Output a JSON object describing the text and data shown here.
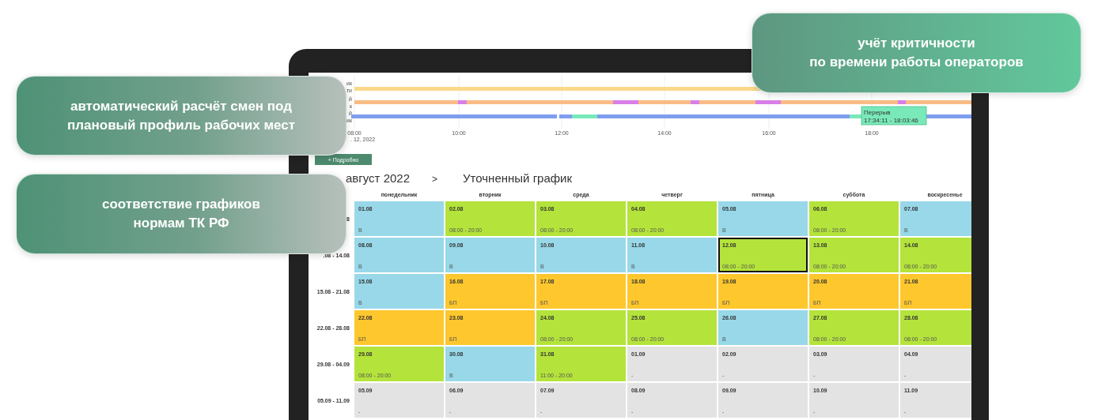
{
  "callouts": [
    {
      "lines": [
        "автоматический расчёт смен под",
        "плановый профиль рабочих мест"
      ]
    },
    {
      "lines": [
        "соответствие графиков",
        "нормам ТК РФ"
      ]
    },
    {
      "lines": [
        "учёт критичности",
        "по времени работы операторов"
      ]
    }
  ],
  "timeline": {
    "row_labels": [
      "ик",
      "ти",
      "й",
      "к",
      "й",
      "ик"
    ],
    "ticks": [
      "08:00",
      "10:00",
      "12:00",
      "14:00",
      "16:00",
      "18:00"
    ],
    "date": ". 12, 2022",
    "tooltip": {
      "title": "Перерыв",
      "range": "17:34:11 - 18:03:46"
    }
  },
  "details_button": "+ Подробно",
  "breadcrumb": {
    "month": "август 2022",
    "separator": ">",
    "view": "Уточненный график"
  },
  "table": {
    "weekdays": [
      "понедельник",
      "вторник",
      "среда",
      "четверг",
      "пятница",
      "суббота",
      "воскресенье"
    ],
    "weeks": [
      {
        "label": "8",
        "days": [
          {
            "date": "01.08",
            "kind": "off",
            "note": "В",
            "selected": false
          },
          {
            "date": "02.08",
            "kind": "shift",
            "note": "08:00 - 20:00",
            "selected": false
          },
          {
            "date": "03.08",
            "kind": "shift",
            "note": "08:00 - 20:00",
            "selected": false
          },
          {
            "date": "04.08",
            "kind": "shift",
            "note": "08:00 - 20:00",
            "selected": false
          },
          {
            "date": "05.08",
            "kind": "off",
            "note": "В",
            "selected": false
          },
          {
            "date": "06.08",
            "kind": "shift",
            "note": "08:00 - 20:00",
            "selected": false
          },
          {
            "date": "07.08",
            "kind": "off",
            "note": "В",
            "selected": false
          }
        ]
      },
      {
        "label": ".08 - 14.08",
        "days": [
          {
            "date": "08.08",
            "kind": "off",
            "note": "В",
            "selected": false
          },
          {
            "date": "09.08",
            "kind": "off",
            "note": "В",
            "selected": false
          },
          {
            "date": "10.08",
            "kind": "off",
            "note": "В",
            "selected": false
          },
          {
            "date": "11.08",
            "kind": "off",
            "note": "В",
            "selected": false
          },
          {
            "date": "12.08",
            "kind": "shift",
            "note": "08:00 - 20:00",
            "selected": true
          },
          {
            "date": "13.08",
            "kind": "shift",
            "note": "08:00 - 20:00",
            "selected": false
          },
          {
            "date": "14.08",
            "kind": "shift",
            "note": "08:00 - 20:00",
            "selected": false
          }
        ]
      },
      {
        "label": "15.08 - 21.08",
        "days": [
          {
            "date": "15.08",
            "kind": "off",
            "note": "В",
            "selected": false
          },
          {
            "date": "16.08",
            "kind": "sick",
            "note": "БП",
            "selected": false
          },
          {
            "date": "17.08",
            "kind": "sick",
            "note": "БП",
            "selected": false
          },
          {
            "date": "18.08",
            "kind": "sick",
            "note": "БП",
            "selected": false
          },
          {
            "date": "19.08",
            "kind": "sick",
            "note": "БП",
            "selected": false
          },
          {
            "date": "20.08",
            "kind": "sick",
            "note": "БП",
            "selected": false
          },
          {
            "date": "21.08",
            "kind": "sick",
            "note": "БП",
            "selected": false
          }
        ]
      },
      {
        "label": "22.08 - 28.08",
        "days": [
          {
            "date": "22.08",
            "kind": "sick",
            "note": "БП",
            "selected": false
          },
          {
            "date": "23.08",
            "kind": "sick",
            "note": "БП",
            "selected": false
          },
          {
            "date": "24.08",
            "kind": "shift",
            "note": "08:00 - 20:00",
            "selected": false
          },
          {
            "date": "25.08",
            "kind": "shift",
            "note": "08:00 - 20:00",
            "selected": false
          },
          {
            "date": "26.08",
            "kind": "off",
            "note": "В",
            "selected": false
          },
          {
            "date": "27.08",
            "kind": "shift",
            "note": "08:00 - 20:00",
            "selected": false
          },
          {
            "date": "28.08",
            "kind": "shift",
            "note": "08:00 - 20:00",
            "selected": false
          }
        ]
      },
      {
        "label": "29.08 - 04.09",
        "days": [
          {
            "date": "29.08",
            "kind": "shift",
            "note": "08:00 - 20:00",
            "selected": false
          },
          {
            "date": "30.08",
            "kind": "off",
            "note": "В",
            "selected": false
          },
          {
            "date": "31.08",
            "kind": "shift",
            "note": "11:00 - 20:00",
            "selected": false
          },
          {
            "date": "01.09",
            "kind": "empty",
            "note": "-",
            "selected": false
          },
          {
            "date": "02.09",
            "kind": "empty",
            "note": "-",
            "selected": false
          },
          {
            "date": "03.09",
            "kind": "empty",
            "note": "-",
            "selected": false
          },
          {
            "date": "04.09",
            "kind": "empty",
            "note": "-",
            "selected": false
          }
        ]
      },
      {
        "label": "05.09 - 11.09",
        "days": [
          {
            "date": "05.09",
            "kind": "empty",
            "note": "-",
            "selected": false
          },
          {
            "date": "06.09",
            "kind": "empty",
            "note": "-",
            "selected": false
          },
          {
            "date": "07.09",
            "kind": "empty",
            "note": "-",
            "selected": false
          },
          {
            "date": "08.09",
            "kind": "empty",
            "note": "-",
            "selected": false
          },
          {
            "date": "09.09",
            "kind": "empty",
            "note": "-",
            "selected": false
          },
          {
            "date": "10.09",
            "kind": "empty",
            "note": "-",
            "selected": false
          },
          {
            "date": "11.09",
            "kind": "empty",
            "note": "-",
            "selected": false
          }
        ]
      }
    ]
  }
}
